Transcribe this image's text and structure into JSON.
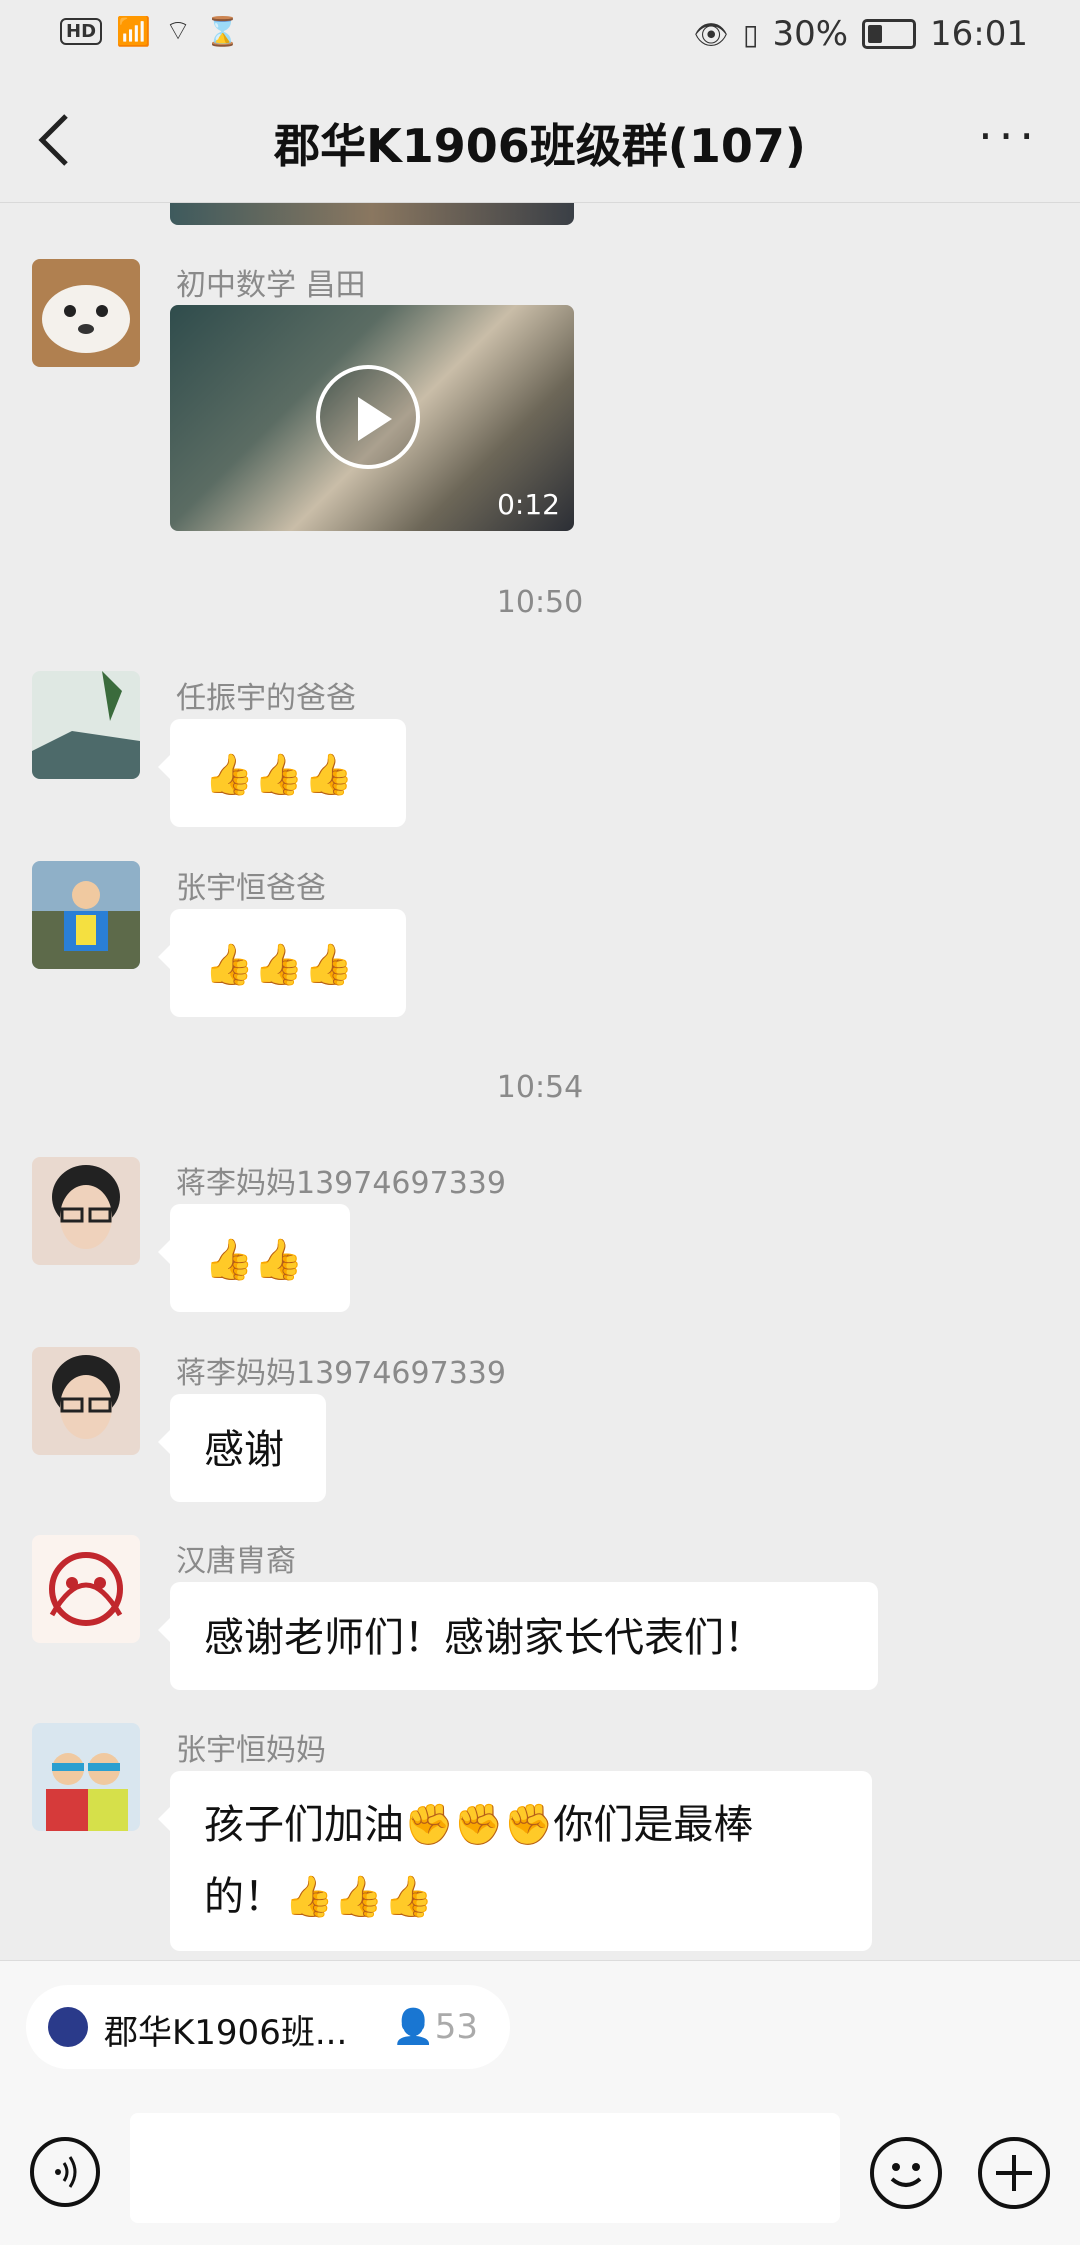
{
  "status_bar": {
    "hd": "HD",
    "network": "4G",
    "battery": "30%",
    "time": "16:01"
  },
  "nav": {
    "title": "郡华K1906班级群(107)",
    "back_icon": "chevron-left-icon",
    "more_label": "···"
  },
  "messages": [
    {
      "sender": "初中数学 昌田",
      "type": "video",
      "duration": "0:12"
    },
    {
      "time": "10:50"
    },
    {
      "sender": "任振宇的爸爸",
      "type": "emoji",
      "content": "👍👍👍"
    },
    {
      "sender": "张宇恒爸爸",
      "type": "emoji",
      "content": "👍👍👍"
    },
    {
      "time": "10:54"
    },
    {
      "sender": "蒋李妈妈13974697339",
      "type": "emoji",
      "content": "👍👍"
    },
    {
      "sender": "蒋李妈妈13974697339",
      "type": "text",
      "content": "感谢"
    },
    {
      "sender": "汉唐胄裔",
      "type": "text",
      "content": "感谢老师们！感谢家长代表们！"
    },
    {
      "sender": "张宇恒妈妈",
      "type": "text",
      "line1": "孩子们加油✊✊✊你们是最棒",
      "line2": "的！👍👍👍"
    }
  ],
  "bottom": {
    "group_chip_name": "郡华K1906班...",
    "group_chip_count": "53",
    "input_placeholder": ""
  }
}
